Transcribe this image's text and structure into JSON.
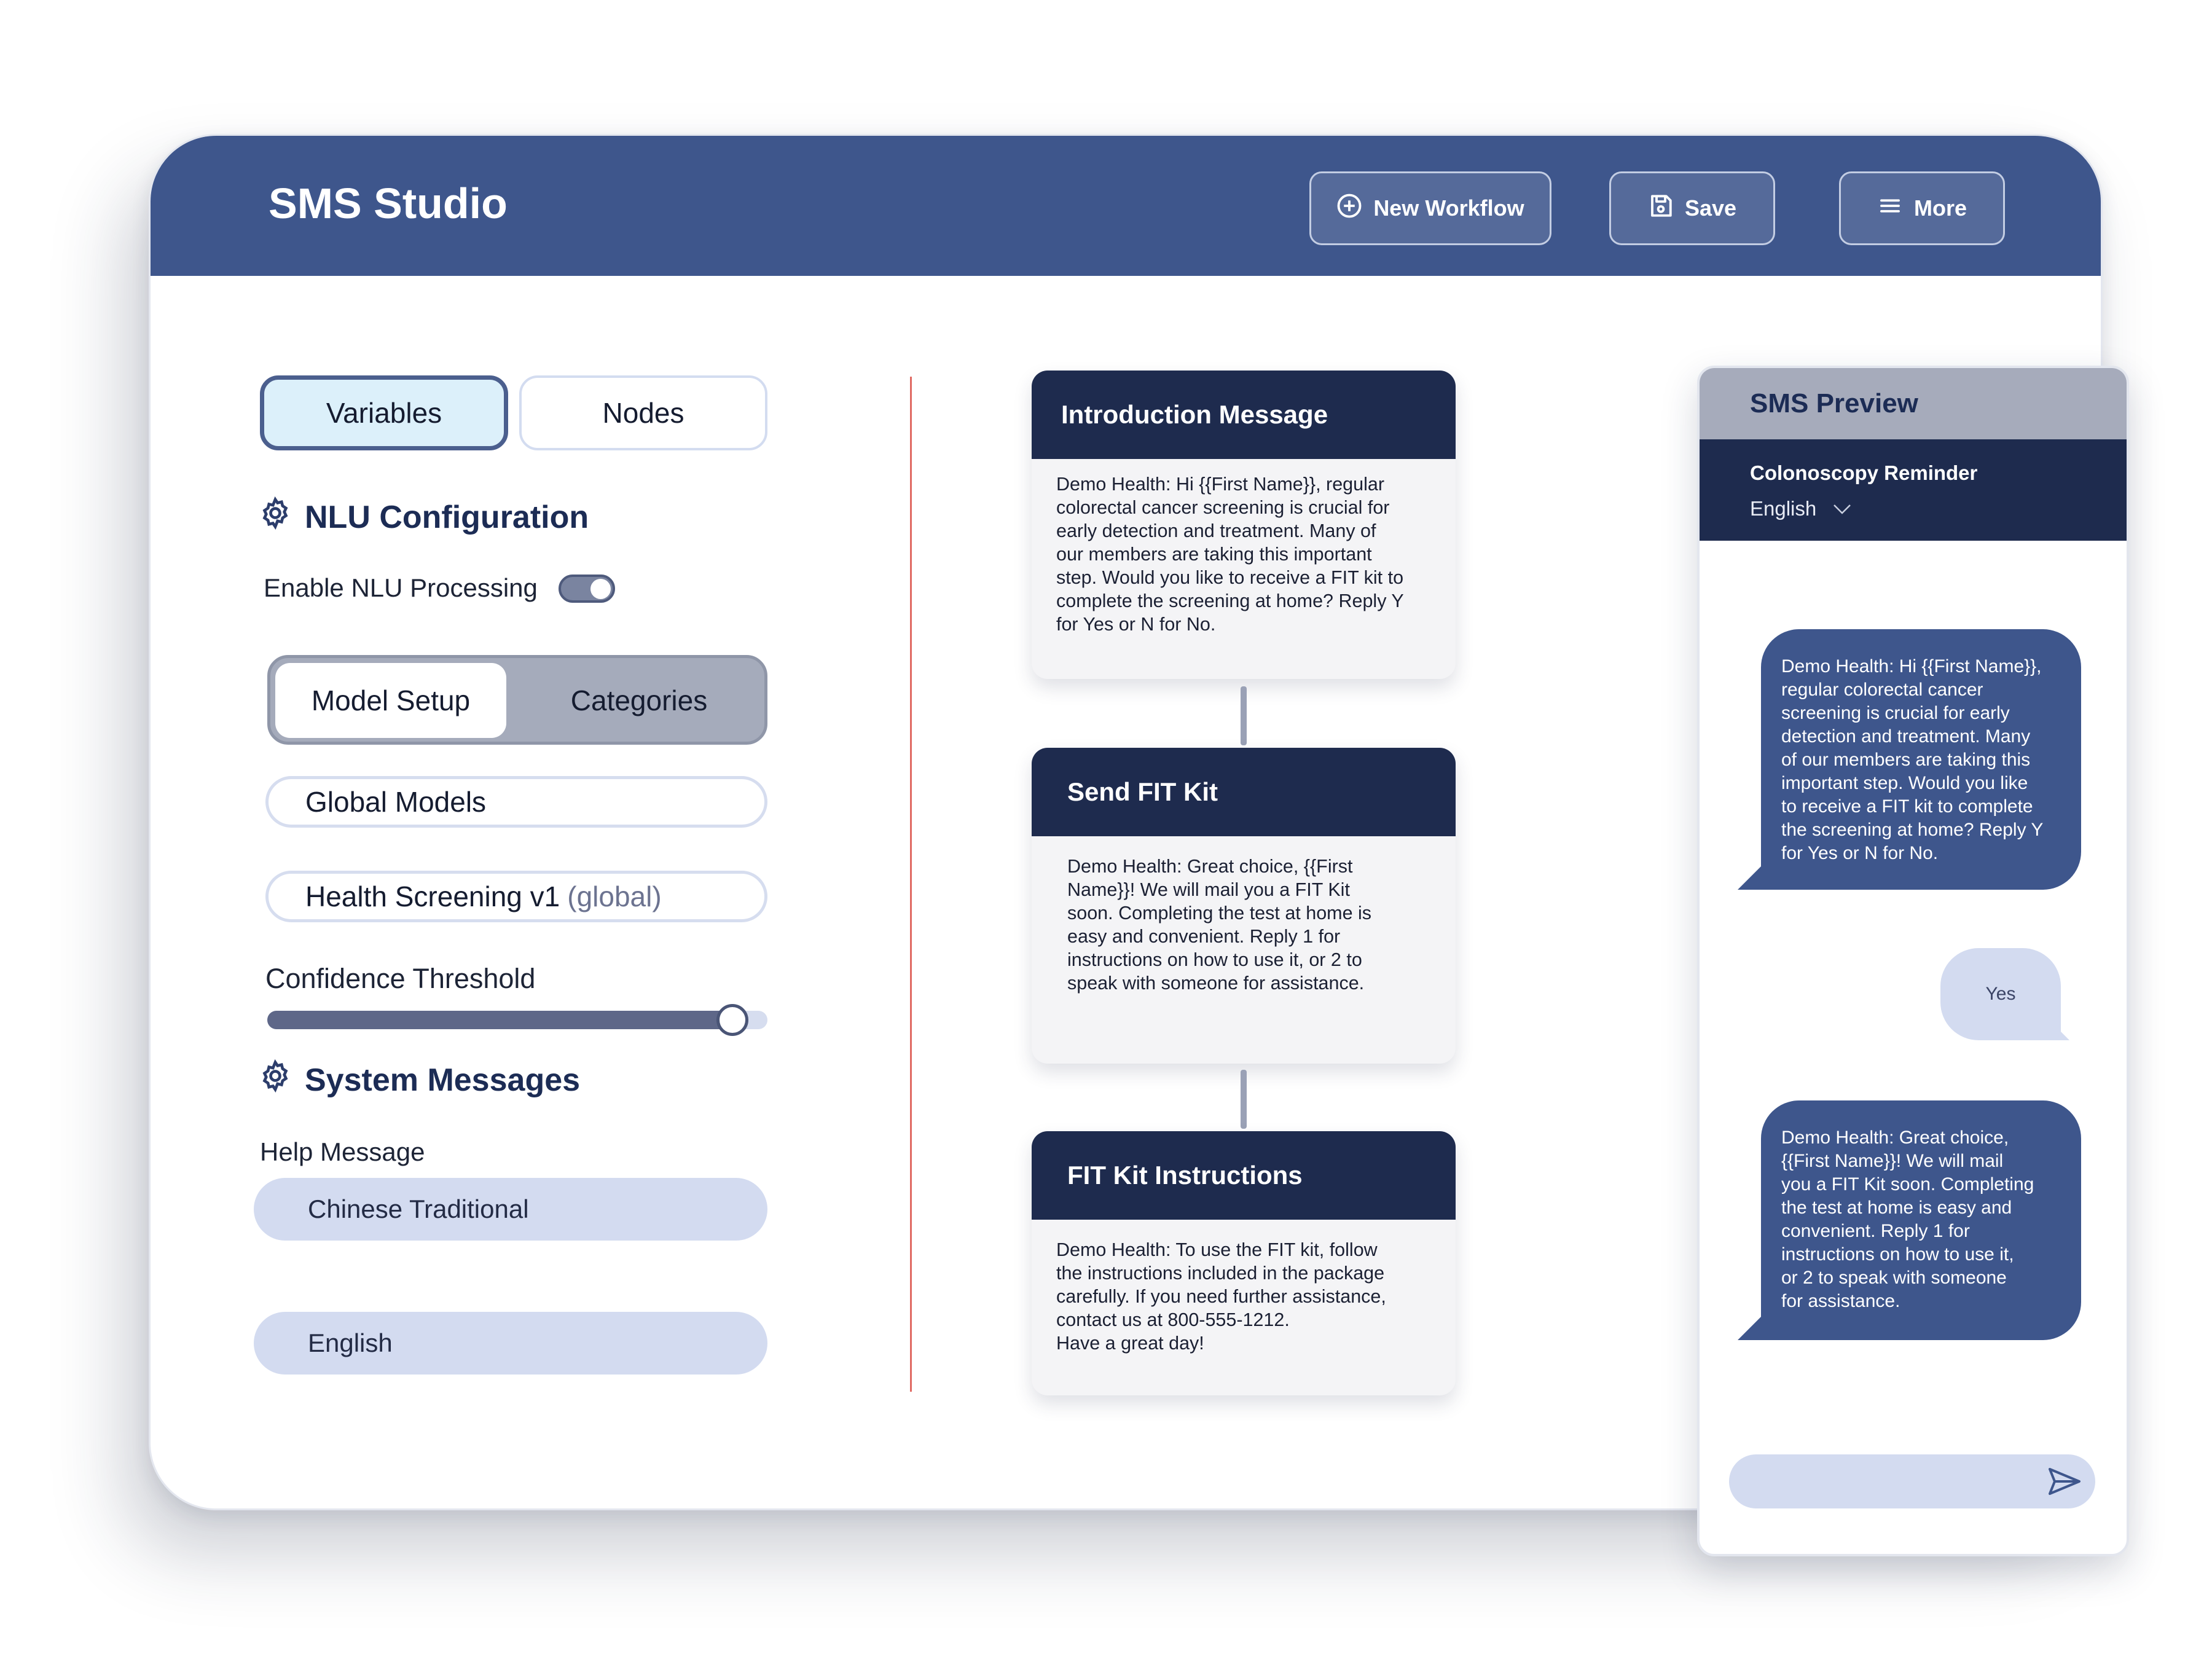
{
  "header": {
    "title": "SMS Studio",
    "buttons": {
      "new_workflow": "New Workflow",
      "save": "Save",
      "more": "More"
    }
  },
  "left_panel": {
    "segments": {
      "variables": "Variables",
      "nodes": "Nodes"
    },
    "nlu": {
      "heading": "NLU Configuration",
      "enable_label": "Enable NLU Processing",
      "enabled": true
    },
    "tabs": {
      "model_setup": "Model Setup",
      "categories": "Categories"
    },
    "global_models": "Global Models",
    "model_name": "Health Screening v1",
    "model_scope": "(global)",
    "confidence": {
      "label": "Confidence Threshold",
      "value": 0.93
    },
    "system_messages": {
      "heading": "System Messages",
      "help_label": "Help Message",
      "languages": [
        "Chinese Traditional",
        "English"
      ]
    }
  },
  "flow": {
    "nodes": [
      {
        "title": "Introduction Message",
        "body": "Demo Health: Hi {{First Name}}, regular\ncolorectal cancer screening is crucial for\nearly detection and treatment. Many of\nour members are taking this important\nstep. Would you like to receive a FIT kit to\ncomplete the screening at home? Reply Y\nfor Yes or N for No."
      },
      {
        "title": "Send FIT Kit",
        "body": "Demo Health: Great choice, {{First\nName}}! We will mail you a FIT Kit\nsoon. Completing the test at home is\neasy and convenient. Reply 1 for\ninstructions on how to use it, or 2 to\nspeak with someone for assistance."
      },
      {
        "title": "FIT Kit Instructions",
        "body": "Demo Health: To use the FIT kit, follow\nthe instructions included in the package\ncarefully. If you need further assistance,\ncontact us at 800-555-1212.\nHave a great day!"
      }
    ]
  },
  "preview": {
    "title": "SMS Preview",
    "campaign": "Colonoscopy Reminder",
    "language": "English",
    "messages": [
      {
        "from": "bot",
        "text": "Demo Health: Hi {{First Name}},\nregular colorectal cancer\nscreening is crucial for early\ndetection and treatment. Many\nof our members are taking this\nimportant step. Would you like\nto receive a FIT kit to complete\nthe screening at home? Reply Y\nfor Yes or N for No."
      },
      {
        "from": "user",
        "text": "Yes"
      },
      {
        "from": "bot",
        "text": "Demo Health: Great choice,\n{{First Name}}! We will mail\nyou a FIT Kit soon. Completing\nthe test at home is easy and\nconvenient. Reply 1 for\ninstructions on how to use it,\nor 2 to speak with someone\nfor assistance."
      }
    ]
  },
  "colors": {
    "header": "#3e568c",
    "dark_navy": "#1e2b4e",
    "accent_divider": "#e06a63",
    "pill": "#d3dbf0"
  },
  "icons": [
    "plus-circle-icon",
    "floppy-disk-icon",
    "hamburger-menu-icon",
    "gear-icon",
    "chevron-down-icon",
    "send-icon"
  ]
}
